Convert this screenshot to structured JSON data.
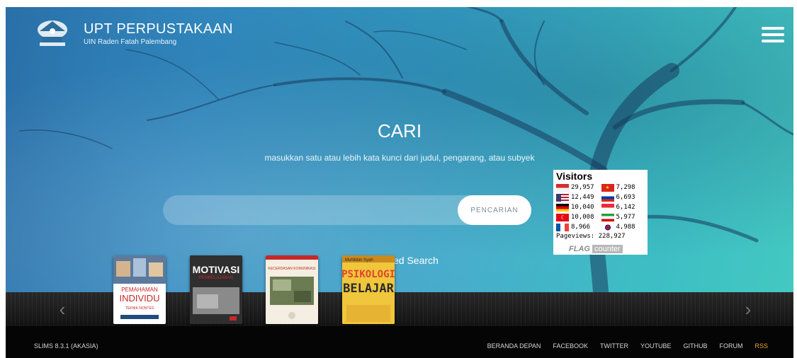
{
  "header": {
    "title": "UPT PERPUSTAKAAN",
    "subtitle": "UIN Raden Fatah Palembang",
    "logo_icon": "uin-raden-fatah-logo",
    "menu_icon": "hamburger-menu-icon"
  },
  "search": {
    "heading": "CARI",
    "description": "masukkan satu atau lebih kata kunci dari judul, pengarang, atau subyek",
    "placeholder": "",
    "button_label": "PENCARIAN",
    "advanced_label": "ced Search"
  },
  "visitors": {
    "title": "Visitors",
    "counts": [
      {
        "flag": "id",
        "value": "29,957"
      },
      {
        "flag": "vn",
        "value": "7,298"
      },
      {
        "flag": "us",
        "value": "12,449"
      },
      {
        "flag": "ru",
        "value": "6,693"
      },
      {
        "flag": "de",
        "value": "10,040"
      },
      {
        "flag": "sg",
        "value": "6,142"
      },
      {
        "flag": "tr",
        "value": "10,008"
      },
      {
        "flag": "ir",
        "value": "5,977"
      },
      {
        "flag": "fr",
        "value": "8,966"
      },
      {
        "flag": "kr",
        "value": "4,988"
      }
    ],
    "pageviews": "Pageviews: 228,927",
    "brand_flag": "FLAG",
    "brand_counter": "counter"
  },
  "carousel": {
    "books": [
      {
        "title": "PEMAHAMAN INDIVIDU",
        "subtitle": "TEKNIK NONTES"
      },
      {
        "title": "MOTIVASI",
        "subtitle": "PEMBELAJARAN"
      },
      {
        "title": "KECERDASAN KOMUNIKASI",
        "subtitle": ""
      },
      {
        "title": "PSIKOLOGI BELAJAR",
        "subtitle": "Muhibbin Syah"
      }
    ]
  },
  "footer": {
    "version": "SLIMS 8.3.1 (AKASIA)",
    "links": [
      "BERANDA DEPAN",
      "FACEBOOK",
      "TWITTER",
      "YOUTUBE",
      "GITHUB",
      "FORUM",
      "RSS"
    ]
  },
  "colors": {
    "hero_start": "#2a6fa8",
    "hero_end": "#44c8c2",
    "rss": "#f2a72e",
    "footer_bg": "#050505"
  }
}
